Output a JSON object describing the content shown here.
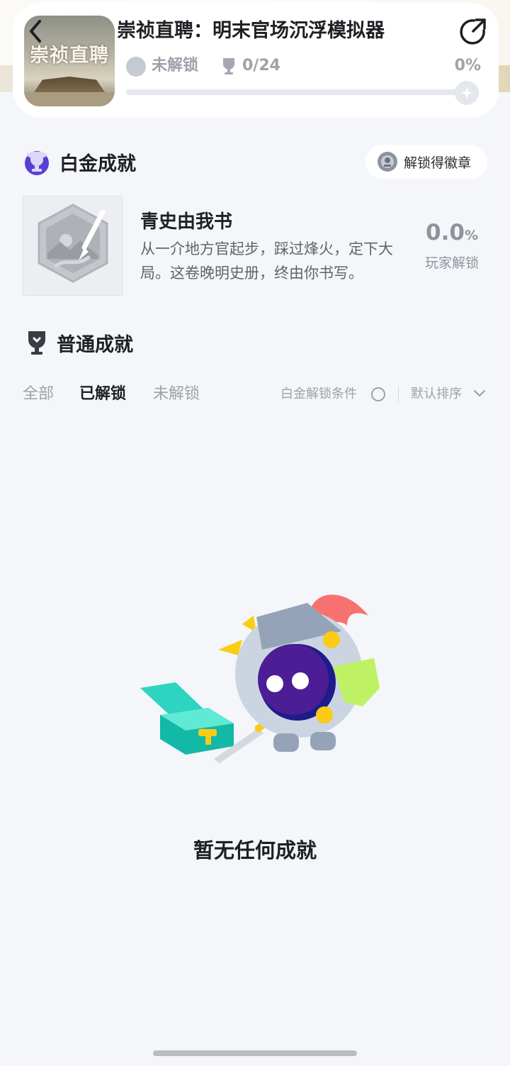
{
  "header": {
    "app_title": "崇祯直聘：明末官场沉浮模拟器",
    "cover_title": "崇祯直聘",
    "status_label": "未解锁",
    "achievement_count": "0/24",
    "progress_percent_label": "0%",
    "progress_fraction": 0
  },
  "platinum": {
    "section_title": "白金成就",
    "badge_button_label": "解锁得徽章",
    "achievement": {
      "name": "青史由我书",
      "description": "从一介地方官起步，踩过烽火，定下大局。这卷晚明史册，终由你书写。",
      "rate_value": "0.0",
      "rate_unit": "%",
      "rate_label": "玩家解锁"
    }
  },
  "normal": {
    "section_title": "普通成就",
    "tabs": [
      {
        "label": "全部",
        "active": false
      },
      {
        "label": "已解锁",
        "active": true
      },
      {
        "label": "未解锁",
        "active": false
      }
    ],
    "filter_label": "白金解锁条件",
    "sort_label": "默认排序",
    "empty_text": "暂无任何成就"
  },
  "colors": {
    "accent_purple": "#5b3fd1",
    "background": "#f4f6f9",
    "muted_text": "#9ea2a9"
  }
}
